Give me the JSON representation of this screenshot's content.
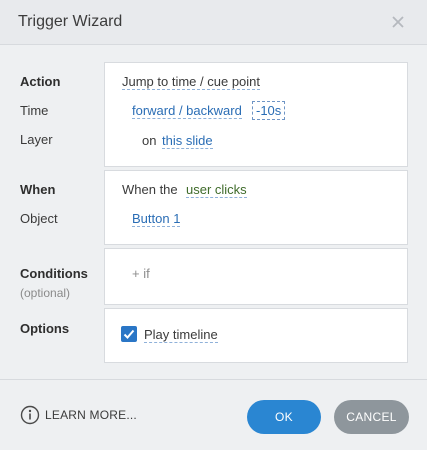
{
  "dialog": {
    "title": "Trigger Wizard"
  },
  "labels": {
    "action": "Action",
    "time": "Time",
    "layer": "Layer",
    "when": "When",
    "object": "Object",
    "conditions": "Conditions",
    "conditions_sub": "(optional)",
    "options": "Options"
  },
  "action_box": {
    "action_value": "Jump to time / cue point",
    "direction_value": "forward / backward",
    "time_value": "-10s",
    "on_text": "on",
    "layer_value": "this slide"
  },
  "when_box": {
    "prefix": "When the",
    "event_value": "user clicks",
    "object_value": "Button 1"
  },
  "conditions_box": {
    "add_label": "+ if"
  },
  "options_box": {
    "play_timeline_label": "Play timeline",
    "play_timeline_checked": true
  },
  "footer": {
    "learn_more": "LEARN MORE...",
    "ok_label": "OK",
    "cancel_label": "CANCEL"
  },
  "colors": {
    "accent": "#2a86d2",
    "link": "#2a6db5",
    "cancel": "#8e969c",
    "background": "#eef0f2"
  }
}
